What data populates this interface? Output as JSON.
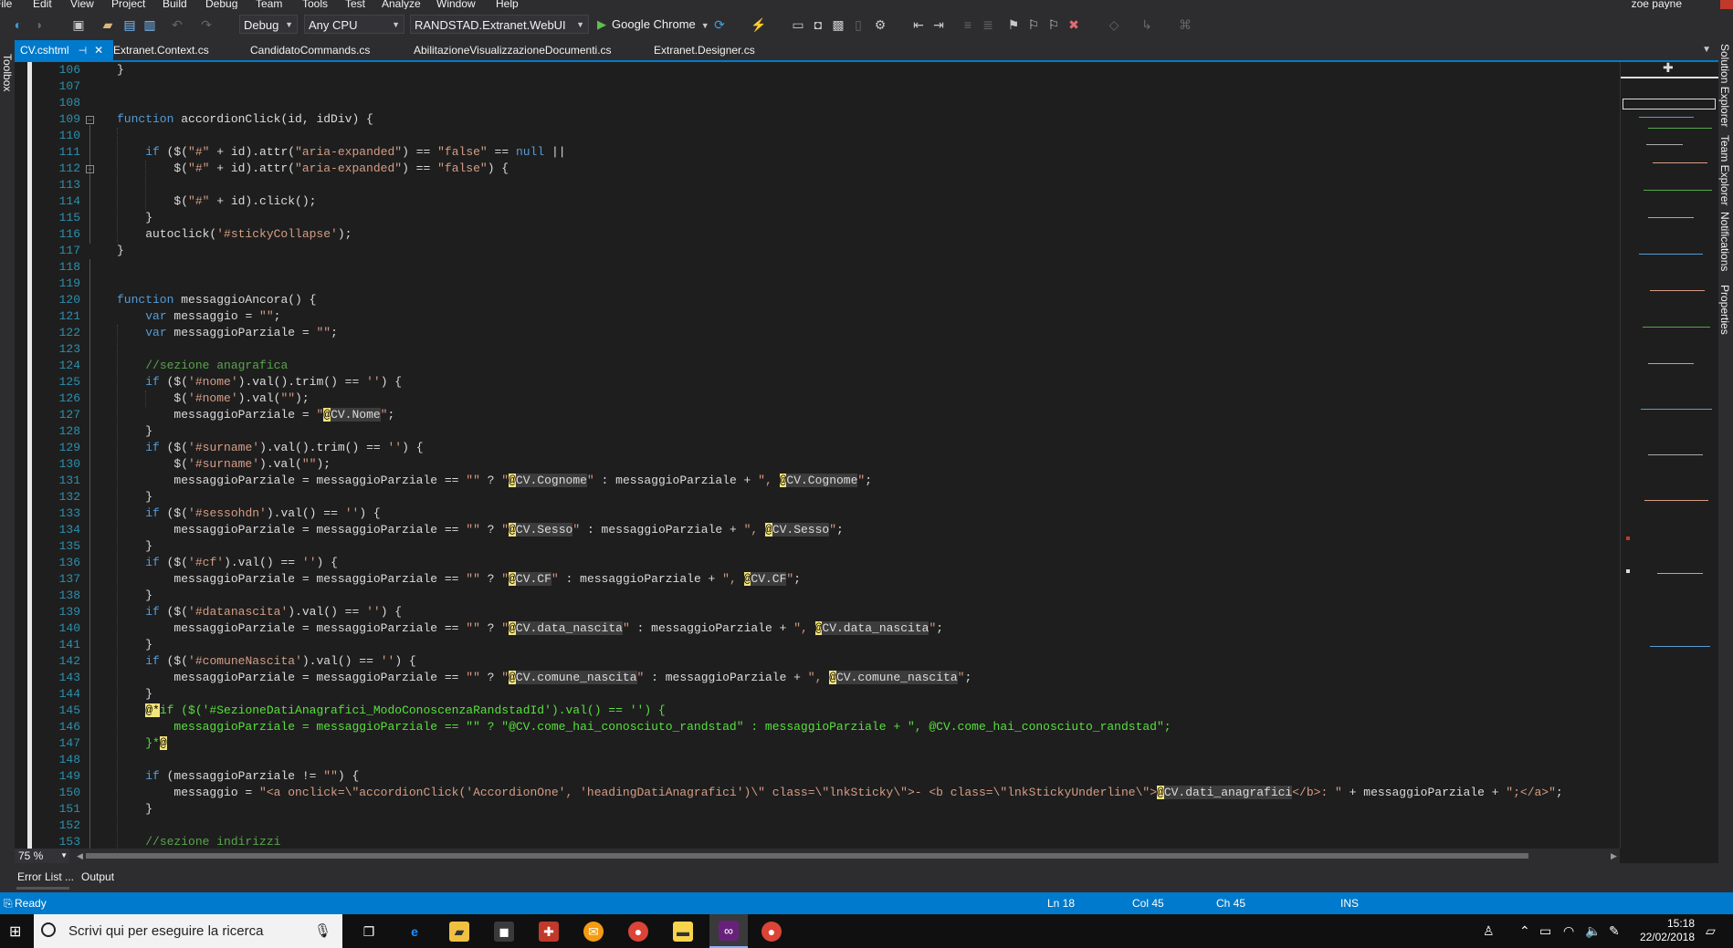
{
  "menu": {
    "items": [
      "File",
      "Edit",
      "View",
      "Project",
      "Build",
      "Debug",
      "Team",
      "Tools",
      "Test",
      "Analyze",
      "Window",
      "Help"
    ],
    "user": "zoe payne"
  },
  "toolbar": {
    "configuration": "Debug",
    "platform": "Any CPU",
    "startup_project": "RANDSTAD.Extranet.WebUI",
    "run_target": "Google Chrome"
  },
  "side_left": {
    "toolbox": "Toolbox"
  },
  "side_right": [
    "Solution Explorer",
    "Team Explorer",
    "Notifications",
    "Properties"
  ],
  "tabs": [
    {
      "label": "CV.cshtml",
      "active": true
    },
    {
      "label": "Extranet.Context.cs",
      "active": false
    },
    {
      "label": "CandidatoCommands.cs",
      "active": false
    },
    {
      "label": "AbilitazioneVisualizzazioneDocumenti.cs",
      "active": false
    },
    {
      "label": "Extranet.Designer.cs",
      "active": false
    }
  ],
  "editor": {
    "line_numbers": [
      "106",
      "107",
      "108",
      "109",
      "110",
      "111",
      "112",
      "113",
      "114",
      "115",
      "116",
      "117",
      "118",
      "119",
      "120",
      "121",
      "122",
      "123",
      "124",
      "125",
      "126",
      "127",
      "128",
      "129",
      "130",
      "131",
      "132",
      "133",
      "134",
      "135",
      "136",
      "137",
      "138",
      "139",
      "140",
      "141",
      "142",
      "143",
      "144",
      "145",
      "146",
      "147",
      "148",
      "149",
      "150",
      "151",
      "152",
      "153"
    ],
    "zoom": "75 %"
  },
  "panels": {
    "error_list": "Error List ...",
    "output": "Output"
  },
  "status": {
    "state": "Ready",
    "line": "Ln 18",
    "col": "Col 45",
    "ch": "Ch 45",
    "mode": "INS"
  },
  "taskbar": {
    "search_placeholder": "Scrivi qui per eseguire la ricerca",
    "time": "15:18",
    "date": "22/02/2018"
  },
  "colors": {
    "accent": "#007acc",
    "editor_bg": "#1e1e1e",
    "chrome_bg": "#2d2d30",
    "keyword": "#569cd6",
    "string": "#d69d85",
    "comment": "#57a64a",
    "razor_at": "#f5e47a"
  }
}
